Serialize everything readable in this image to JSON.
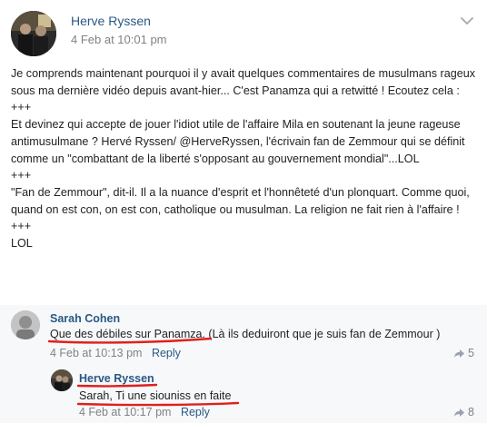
{
  "post": {
    "author": "Herve Ryssen",
    "timestamp": "4 Feb at 10:01 pm",
    "menu_icon": "chevron-down-icon",
    "lines": [
      "Je comprends maintenant pourquoi il y avait quelques commentaires de musulmans rageux sous ma dernière vidéo depuis avant-hier... C'est Panamza qui a retwitté ! Ecoutez cela :",
      "+++",
      "Et devinez qui accepte de jouer l'idiot utile de l'affaire Mila en soutenant la jeune rageuse antimusulmane ? Hervé Ryssen/ @HerveRyssen, l'écrivain fan de Zemmour qui se définit comme un \"combattant de la liberté s'opposant au gouvernement mondial\"...LOL",
      "+++",
      "\"Fan de Zemmour\", dit-il. Il a la nuance d'esprit et l'honnêteté d'un plonquart. Comme quoi, quand on est con, on est con, catholique ou musulman. La religion ne fait rien à l'affaire !",
      "+++",
      "LOL"
    ]
  },
  "comments": [
    {
      "author": "Sarah Cohen",
      "text": "Que des débiles sur Panamza. (Là ils deduiront que je suis fan de Zemmour )",
      "timestamp": "4 Feb at 10:13 pm",
      "reply_label": "Reply",
      "share_count": "5"
    },
    {
      "author": "Herve Ryssen",
      "text": "Sarah, Ti une siouniss en faite",
      "timestamp": "4 Feb at 10:17 pm",
      "reply_label": "Reply",
      "share_count": "8"
    }
  ],
  "colors": {
    "link": "#2a5885",
    "meta": "#828282",
    "annotation_red": "#e0201c",
    "comments_bg": "#f7f8fa"
  }
}
